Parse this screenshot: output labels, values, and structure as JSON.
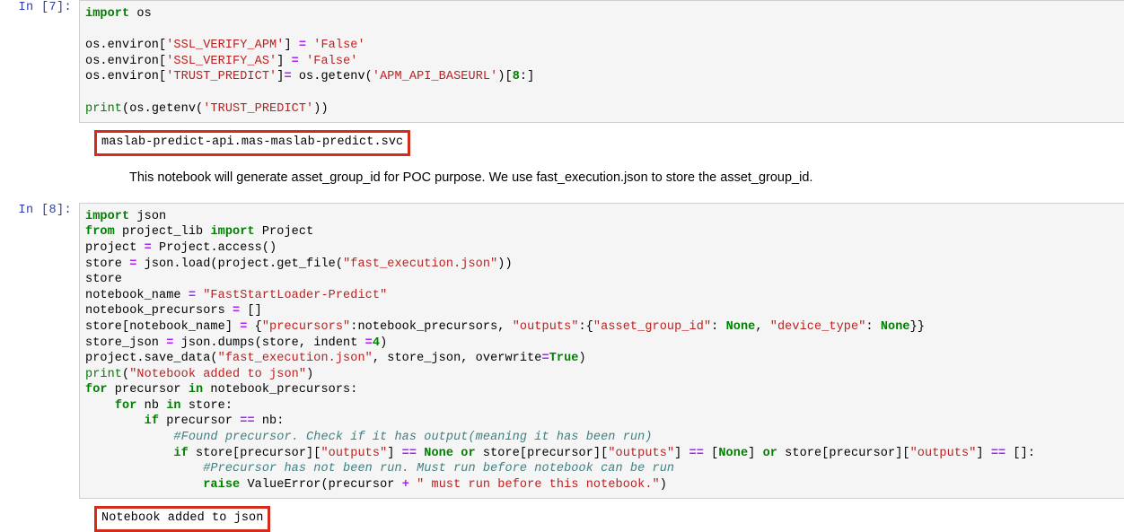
{
  "notebook": {
    "cells": [
      {
        "type": "code",
        "prompt": "In [7]:",
        "code_lines": [
          [
            {
              "t": "import",
              "c": "k"
            },
            {
              "t": " os",
              "c": ""
            }
          ],
          [],
          [
            {
              "t": "os.environ[",
              "c": ""
            },
            {
              "t": "'SSL_VERIFY_APM'",
              "c": "s"
            },
            {
              "t": "] ",
              "c": ""
            },
            {
              "t": "=",
              "c": "o"
            },
            {
              "t": " ",
              "c": ""
            },
            {
              "t": "'False'",
              "c": "s"
            }
          ],
          [
            {
              "t": "os.environ[",
              "c": ""
            },
            {
              "t": "'SSL_VERIFY_AS'",
              "c": "s"
            },
            {
              "t": "] ",
              "c": ""
            },
            {
              "t": "=",
              "c": "o"
            },
            {
              "t": " ",
              "c": ""
            },
            {
              "t": "'False'",
              "c": "s"
            }
          ],
          [
            {
              "t": "os.environ[",
              "c": ""
            },
            {
              "t": "'TRUST_PREDICT'",
              "c": "s"
            },
            {
              "t": "]",
              "c": ""
            },
            {
              "t": "=",
              "c": "o"
            },
            {
              "t": " os.getenv(",
              "c": ""
            },
            {
              "t": "'APM_API_BASEURL'",
              "c": "s"
            },
            {
              "t": ")[",
              "c": ""
            },
            {
              "t": "8",
              "c": "m"
            },
            {
              "t": ":]",
              "c": ""
            }
          ],
          [],
          [
            {
              "t": "print",
              "c": "nb"
            },
            {
              "t": "(os.getenv(",
              "c": ""
            },
            {
              "t": "'TRUST_PREDICT'",
              "c": "s"
            },
            {
              "t": "))",
              "c": ""
            }
          ]
        ],
        "output": "maslab-predict-api.mas-maslab-predict.svc",
        "output_highlighted": true
      },
      {
        "type": "markdown",
        "text": "This notebook will generate asset_group_id for POC purpose. We use fast_execution.json to store the asset_group_id."
      },
      {
        "type": "code",
        "prompt": "In [8]:",
        "code_lines": [
          [
            {
              "t": "import",
              "c": "k"
            },
            {
              "t": " json",
              "c": ""
            }
          ],
          [
            {
              "t": "from",
              "c": "k"
            },
            {
              "t": " project_lib ",
              "c": ""
            },
            {
              "t": "import",
              "c": "k"
            },
            {
              "t": " Project",
              "c": ""
            }
          ],
          [
            {
              "t": "project ",
              "c": ""
            },
            {
              "t": "=",
              "c": "o"
            },
            {
              "t": " Project.access()",
              "c": ""
            }
          ],
          [
            {
              "t": "store ",
              "c": ""
            },
            {
              "t": "=",
              "c": "o"
            },
            {
              "t": " json.load(project.get_file(",
              "c": ""
            },
            {
              "t": "\"fast_execution.json\"",
              "c": "s"
            },
            {
              "t": "))",
              "c": ""
            }
          ],
          [
            {
              "t": "store",
              "c": ""
            }
          ],
          [
            {
              "t": "notebook_name ",
              "c": ""
            },
            {
              "t": "=",
              "c": "o"
            },
            {
              "t": " ",
              "c": ""
            },
            {
              "t": "\"FastStartLoader-Predict\"",
              "c": "s"
            }
          ],
          [
            {
              "t": "notebook_precursors ",
              "c": ""
            },
            {
              "t": "=",
              "c": "o"
            },
            {
              "t": " []",
              "c": ""
            }
          ],
          [
            {
              "t": "store[notebook_name] ",
              "c": ""
            },
            {
              "t": "=",
              "c": "o"
            },
            {
              "t": " {",
              "c": ""
            },
            {
              "t": "\"precursors\"",
              "c": "s"
            },
            {
              "t": ":notebook_precursors, ",
              "c": ""
            },
            {
              "t": "\"outputs\"",
              "c": "s"
            },
            {
              "t": ":{",
              "c": ""
            },
            {
              "t": "\"asset_group_id\"",
              "c": "s"
            },
            {
              "t": ": ",
              "c": ""
            },
            {
              "t": "None",
              "c": "kc"
            },
            {
              "t": ", ",
              "c": ""
            },
            {
              "t": "\"device_type\"",
              "c": "s"
            },
            {
              "t": ": ",
              "c": ""
            },
            {
              "t": "None",
              "c": "kc"
            },
            {
              "t": "}}",
              "c": ""
            }
          ],
          [
            {
              "t": "store_json ",
              "c": ""
            },
            {
              "t": "=",
              "c": "o"
            },
            {
              "t": " json.dumps(store, indent ",
              "c": ""
            },
            {
              "t": "=",
              "c": "o"
            },
            {
              "t": "4",
              "c": "m"
            },
            {
              "t": ")",
              "c": ""
            }
          ],
          [
            {
              "t": "project.save_data(",
              "c": ""
            },
            {
              "t": "\"fast_execution.json\"",
              "c": "s"
            },
            {
              "t": ", store_json, overwrite",
              "c": ""
            },
            {
              "t": "=",
              "c": "o"
            },
            {
              "t": "True",
              "c": "kc"
            },
            {
              "t": ")",
              "c": ""
            }
          ],
          [
            {
              "t": "print",
              "c": "nb"
            },
            {
              "t": "(",
              "c": ""
            },
            {
              "t": "\"Notebook added to json\"",
              "c": "s"
            },
            {
              "t": ")",
              "c": ""
            }
          ],
          [
            {
              "t": "for",
              "c": "k"
            },
            {
              "t": " precursor ",
              "c": ""
            },
            {
              "t": "in",
              "c": "k"
            },
            {
              "t": " notebook_precursors:",
              "c": ""
            }
          ],
          [
            {
              "t": "    ",
              "c": ""
            },
            {
              "t": "for",
              "c": "k"
            },
            {
              "t": " nb ",
              "c": ""
            },
            {
              "t": "in",
              "c": "k"
            },
            {
              "t": " store:",
              "c": ""
            }
          ],
          [
            {
              "t": "        ",
              "c": ""
            },
            {
              "t": "if",
              "c": "k"
            },
            {
              "t": " precursor ",
              "c": ""
            },
            {
              "t": "==",
              "c": "o"
            },
            {
              "t": " nb:",
              "c": ""
            }
          ],
          [
            {
              "t": "            ",
              "c": ""
            },
            {
              "t": "#Found precursor. Check if it has output(meaning it has been run)",
              "c": "c"
            }
          ],
          [
            {
              "t": "            ",
              "c": ""
            },
            {
              "t": "if",
              "c": "k"
            },
            {
              "t": " store[precursor][",
              "c": ""
            },
            {
              "t": "\"outputs\"",
              "c": "s"
            },
            {
              "t": "] ",
              "c": ""
            },
            {
              "t": "==",
              "c": "o"
            },
            {
              "t": " ",
              "c": ""
            },
            {
              "t": "None",
              "c": "kc"
            },
            {
              "t": " ",
              "c": ""
            },
            {
              "t": "or",
              "c": "k"
            },
            {
              "t": " store[precursor][",
              "c": ""
            },
            {
              "t": "\"outputs\"",
              "c": "s"
            },
            {
              "t": "] ",
              "c": ""
            },
            {
              "t": "==",
              "c": "o"
            },
            {
              "t": " [",
              "c": ""
            },
            {
              "t": "None",
              "c": "kc"
            },
            {
              "t": "] ",
              "c": ""
            },
            {
              "t": "or",
              "c": "k"
            },
            {
              "t": " store[precursor][",
              "c": ""
            },
            {
              "t": "\"outputs\"",
              "c": "s"
            },
            {
              "t": "] ",
              "c": ""
            },
            {
              "t": "==",
              "c": "o"
            },
            {
              "t": " []:",
              "c": ""
            }
          ],
          [
            {
              "t": "                ",
              "c": ""
            },
            {
              "t": "#Precursor has not been run. Must run before notebook can be run",
              "c": "c"
            }
          ],
          [
            {
              "t": "                ",
              "c": ""
            },
            {
              "t": "raise",
              "c": "k"
            },
            {
              "t": " ValueError(precursor ",
              "c": ""
            },
            {
              "t": "+",
              "c": "o"
            },
            {
              "t": " ",
              "c": ""
            },
            {
              "t": "\" must run before this notebook.\"",
              "c": "s"
            },
            {
              "t": ")",
              "c": ""
            }
          ]
        ],
        "output": "Notebook added to json",
        "output_highlighted": true
      }
    ]
  },
  "colors": {
    "cell_background": "#f5f5f5",
    "prompt_color": "#303f9f",
    "string": "#ba2121",
    "keyword": "#008000",
    "operator": "#aa22ff",
    "comment": "#408080",
    "number": "#008000",
    "highlight_box": "#d42b1a"
  }
}
